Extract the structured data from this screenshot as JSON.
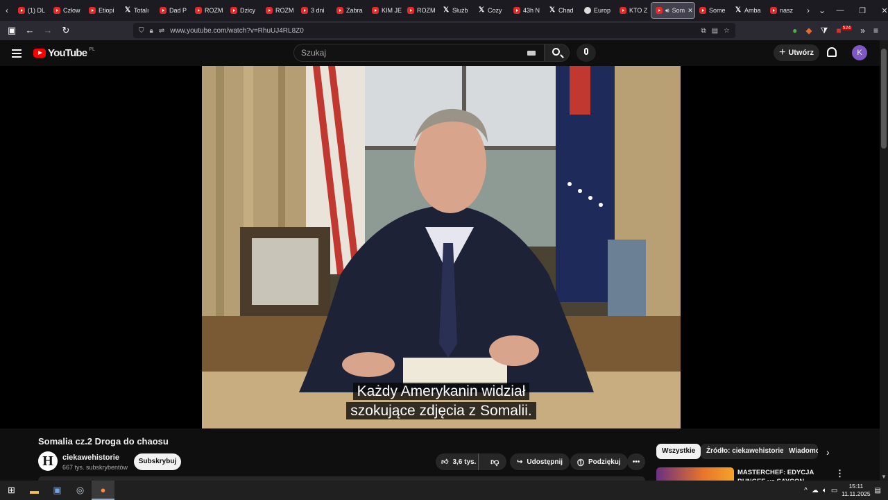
{
  "browser": {
    "tabs": [
      {
        "label": "(1) DL",
        "icon": "youtube"
      },
      {
        "label": "Człow",
        "icon": "youtube"
      },
      {
        "label": "Etiopi",
        "icon": "youtube"
      },
      {
        "label": "Totalı",
        "icon": "x"
      },
      {
        "label": "Dad P",
        "icon": "youtube"
      },
      {
        "label": "ROZM",
        "icon": "youtube"
      },
      {
        "label": "Dzicy",
        "icon": "youtube"
      },
      {
        "label": "ROZM",
        "icon": "youtube"
      },
      {
        "label": "3 dni",
        "icon": "youtube"
      },
      {
        "label": "Zabra",
        "icon": "youtube"
      },
      {
        "label": "KIM JE",
        "icon": "youtube"
      },
      {
        "label": "ROZM",
        "icon": "youtube"
      },
      {
        "label": "Służb",
        "icon": "x"
      },
      {
        "label": "Cozy",
        "icon": "x"
      },
      {
        "label": "43h N",
        "icon": "youtube"
      },
      {
        "label": "Chad",
        "icon": "x"
      },
      {
        "label": "Europ",
        "icon": "globe"
      },
      {
        "label": "KTO Z",
        "icon": "youtube"
      },
      {
        "label": "Som",
        "icon": "youtube",
        "active": true
      },
      {
        "label": "Some",
        "icon": "youtube"
      },
      {
        "label": "Amba",
        "icon": "x"
      },
      {
        "label": "nasz",
        "icon": "youtube"
      }
    ],
    "url": "www.youtube.com/watch?v=RhuUJ4RL8Z0",
    "extension_badge": "524"
  },
  "youtube": {
    "logo_text": "YouTube",
    "country_code": "PL",
    "search_placeholder": "Szukaj",
    "create_label": "Utwórz",
    "avatar_letter": "K"
  },
  "video": {
    "caption_line1": "Każdy Amerykanin widział",
    "caption_line2": "szokujące zdjęcia z Somalii.",
    "title": "Somalia cz.2 Droga do chaosu",
    "channel_logo_letter": "H",
    "channel_name": "ciekawehistorie",
    "subscribers": "667 tys. subskrybentów",
    "subscribe_label": "Subskrybuj",
    "likes": "3,6 tys.",
    "share_label": "Udostępnij",
    "thanks_label": "Podziękuj"
  },
  "sidebar": {
    "chips": [
      "Wszystkie",
      "Źródło: ciekawehistorie",
      "Wiadomo"
    ],
    "rec_title": "MASTERCHEF: EDYCJA BUNGEE vs SAYCON"
  },
  "taskbar": {
    "time": "15:11",
    "date": "11.11.2025"
  }
}
